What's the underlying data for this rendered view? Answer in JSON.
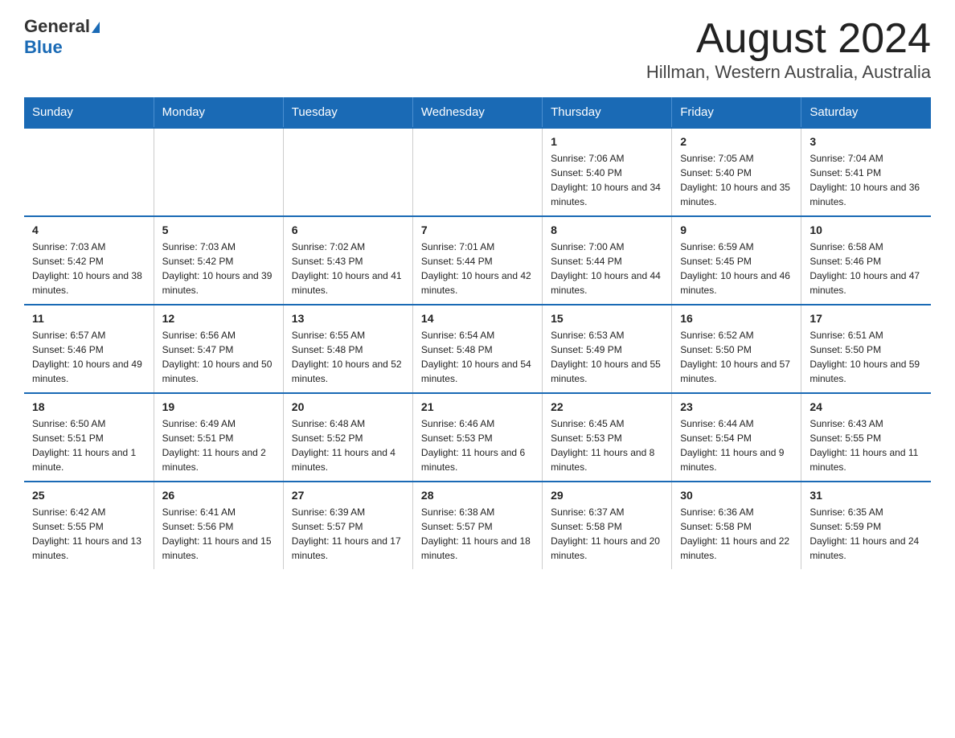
{
  "header": {
    "logo_line1": "General",
    "logo_line2": "Blue",
    "title": "August 2024",
    "subtitle": "Hillman, Western Australia, Australia"
  },
  "days_of_week": [
    "Sunday",
    "Monday",
    "Tuesday",
    "Wednesday",
    "Thursday",
    "Friday",
    "Saturday"
  ],
  "weeks": [
    [
      {
        "day": "",
        "info": ""
      },
      {
        "day": "",
        "info": ""
      },
      {
        "day": "",
        "info": ""
      },
      {
        "day": "",
        "info": ""
      },
      {
        "day": "1",
        "info": "Sunrise: 7:06 AM\nSunset: 5:40 PM\nDaylight: 10 hours and 34 minutes."
      },
      {
        "day": "2",
        "info": "Sunrise: 7:05 AM\nSunset: 5:40 PM\nDaylight: 10 hours and 35 minutes."
      },
      {
        "day": "3",
        "info": "Sunrise: 7:04 AM\nSunset: 5:41 PM\nDaylight: 10 hours and 36 minutes."
      }
    ],
    [
      {
        "day": "4",
        "info": "Sunrise: 7:03 AM\nSunset: 5:42 PM\nDaylight: 10 hours and 38 minutes."
      },
      {
        "day": "5",
        "info": "Sunrise: 7:03 AM\nSunset: 5:42 PM\nDaylight: 10 hours and 39 minutes."
      },
      {
        "day": "6",
        "info": "Sunrise: 7:02 AM\nSunset: 5:43 PM\nDaylight: 10 hours and 41 minutes."
      },
      {
        "day": "7",
        "info": "Sunrise: 7:01 AM\nSunset: 5:44 PM\nDaylight: 10 hours and 42 minutes."
      },
      {
        "day": "8",
        "info": "Sunrise: 7:00 AM\nSunset: 5:44 PM\nDaylight: 10 hours and 44 minutes."
      },
      {
        "day": "9",
        "info": "Sunrise: 6:59 AM\nSunset: 5:45 PM\nDaylight: 10 hours and 46 minutes."
      },
      {
        "day": "10",
        "info": "Sunrise: 6:58 AM\nSunset: 5:46 PM\nDaylight: 10 hours and 47 minutes."
      }
    ],
    [
      {
        "day": "11",
        "info": "Sunrise: 6:57 AM\nSunset: 5:46 PM\nDaylight: 10 hours and 49 minutes."
      },
      {
        "day": "12",
        "info": "Sunrise: 6:56 AM\nSunset: 5:47 PM\nDaylight: 10 hours and 50 minutes."
      },
      {
        "day": "13",
        "info": "Sunrise: 6:55 AM\nSunset: 5:48 PM\nDaylight: 10 hours and 52 minutes."
      },
      {
        "day": "14",
        "info": "Sunrise: 6:54 AM\nSunset: 5:48 PM\nDaylight: 10 hours and 54 minutes."
      },
      {
        "day": "15",
        "info": "Sunrise: 6:53 AM\nSunset: 5:49 PM\nDaylight: 10 hours and 55 minutes."
      },
      {
        "day": "16",
        "info": "Sunrise: 6:52 AM\nSunset: 5:50 PM\nDaylight: 10 hours and 57 minutes."
      },
      {
        "day": "17",
        "info": "Sunrise: 6:51 AM\nSunset: 5:50 PM\nDaylight: 10 hours and 59 minutes."
      }
    ],
    [
      {
        "day": "18",
        "info": "Sunrise: 6:50 AM\nSunset: 5:51 PM\nDaylight: 11 hours and 1 minute."
      },
      {
        "day": "19",
        "info": "Sunrise: 6:49 AM\nSunset: 5:51 PM\nDaylight: 11 hours and 2 minutes."
      },
      {
        "day": "20",
        "info": "Sunrise: 6:48 AM\nSunset: 5:52 PM\nDaylight: 11 hours and 4 minutes."
      },
      {
        "day": "21",
        "info": "Sunrise: 6:46 AM\nSunset: 5:53 PM\nDaylight: 11 hours and 6 minutes."
      },
      {
        "day": "22",
        "info": "Sunrise: 6:45 AM\nSunset: 5:53 PM\nDaylight: 11 hours and 8 minutes."
      },
      {
        "day": "23",
        "info": "Sunrise: 6:44 AM\nSunset: 5:54 PM\nDaylight: 11 hours and 9 minutes."
      },
      {
        "day": "24",
        "info": "Sunrise: 6:43 AM\nSunset: 5:55 PM\nDaylight: 11 hours and 11 minutes."
      }
    ],
    [
      {
        "day": "25",
        "info": "Sunrise: 6:42 AM\nSunset: 5:55 PM\nDaylight: 11 hours and 13 minutes."
      },
      {
        "day": "26",
        "info": "Sunrise: 6:41 AM\nSunset: 5:56 PM\nDaylight: 11 hours and 15 minutes."
      },
      {
        "day": "27",
        "info": "Sunrise: 6:39 AM\nSunset: 5:57 PM\nDaylight: 11 hours and 17 minutes."
      },
      {
        "day": "28",
        "info": "Sunrise: 6:38 AM\nSunset: 5:57 PM\nDaylight: 11 hours and 18 minutes."
      },
      {
        "day": "29",
        "info": "Sunrise: 6:37 AM\nSunset: 5:58 PM\nDaylight: 11 hours and 20 minutes."
      },
      {
        "day": "30",
        "info": "Sunrise: 6:36 AM\nSunset: 5:58 PM\nDaylight: 11 hours and 22 minutes."
      },
      {
        "day": "31",
        "info": "Sunrise: 6:35 AM\nSunset: 5:59 PM\nDaylight: 11 hours and 24 minutes."
      }
    ]
  ]
}
